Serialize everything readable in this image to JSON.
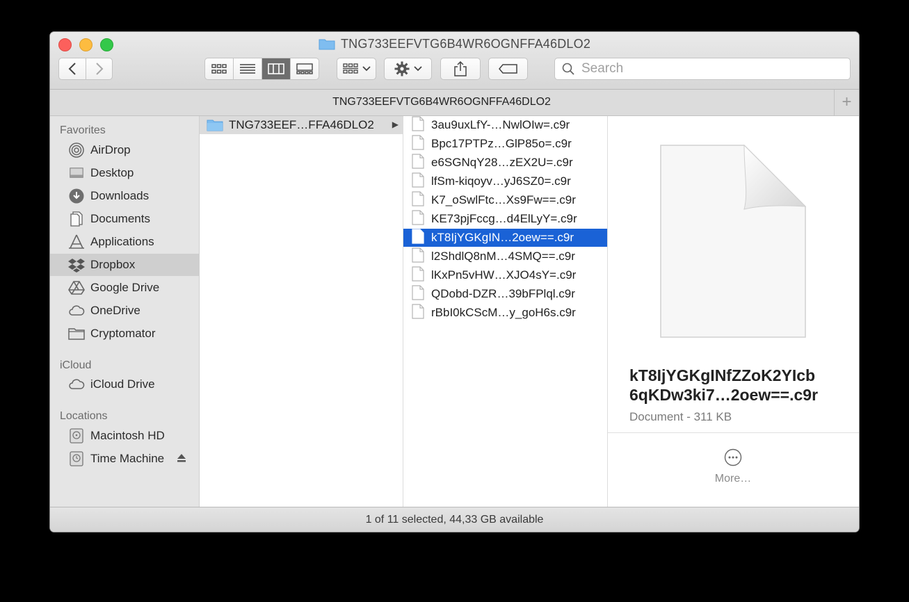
{
  "window": {
    "title": "TNG733EEFVTG6B4WR6OGNFFA46DLO2"
  },
  "toolbar": {
    "back_icon": "chevron-left-icon",
    "forward_icon": "chevron-right-icon",
    "view_modes": [
      "icon-view",
      "list-view",
      "column-view",
      "gallery-view"
    ],
    "active_view": "column-view",
    "search_placeholder": "Search"
  },
  "pathbar": {
    "title": "TNG733EEFVTG6B4WR6OGNFFA46DLO2",
    "add_tab": "+"
  },
  "sidebar": {
    "favorites_header": "Favorites",
    "favorites": [
      {
        "label": "AirDrop",
        "icon": "airdrop-icon"
      },
      {
        "label": "Desktop",
        "icon": "desktop-icon"
      },
      {
        "label": "Downloads",
        "icon": "downloads-icon"
      },
      {
        "label": "Documents",
        "icon": "documents-icon"
      },
      {
        "label": "Applications",
        "icon": "applications-icon"
      },
      {
        "label": "Dropbox",
        "icon": "dropbox-icon",
        "selected": true
      },
      {
        "label": "Google Drive",
        "icon": "google-drive-icon"
      },
      {
        "label": "OneDrive",
        "icon": "onedrive-icon"
      },
      {
        "label": "Cryptomator",
        "icon": "folder-icon"
      }
    ],
    "icloud_header": "iCloud",
    "icloud": [
      {
        "label": "iCloud Drive",
        "icon": "icloud-icon"
      }
    ],
    "locations_header": "Locations",
    "locations": [
      {
        "label": "Macintosh HD",
        "icon": "hard-drive-icon"
      },
      {
        "label": "Time Machine",
        "icon": "time-machine-icon"
      }
    ]
  },
  "column1": {
    "folder": "TNG733EEF…FFA46DLO2"
  },
  "column2": {
    "files": [
      "3au9uxLfY-…NwlOIw=.c9r",
      "Bpc17PTPz…GlP85o=.c9r",
      "e6SGNqY28…zEX2U=.c9r",
      "lfSm-kiqoyv…yJ6SZ0=.c9r",
      "K7_oSwlFtc…Xs9Fw==.c9r",
      "KE73pjFccg…d4ElLyY=.c9r",
      "kT8IjYGKgIN…2oew==.c9r",
      "l2ShdlQ8nM…4SMQ==.c9r",
      "lKxPn5vHW…XJO4sY=.c9r",
      "QDobd-DZR…39bFPlql.c9r",
      "rBbI0kCScM…y_goH6s.c9r"
    ],
    "selected_index": 6
  },
  "preview": {
    "name_line1": "kT8IjYGKgINfZZoK2YIcb",
    "name_line2": "6qKDw3ki7…2oew==.c9r",
    "kind": "Document - 311 KB",
    "more_label": "More…"
  },
  "statusbar": {
    "text": "1 of 11 selected, 44,33 GB available"
  },
  "colors": {
    "selection": "#1a62d6",
    "sidebar_bg": "#e5e5e5",
    "close": "#fc605c",
    "minimize": "#fdbc40",
    "maximize": "#34c84a"
  }
}
